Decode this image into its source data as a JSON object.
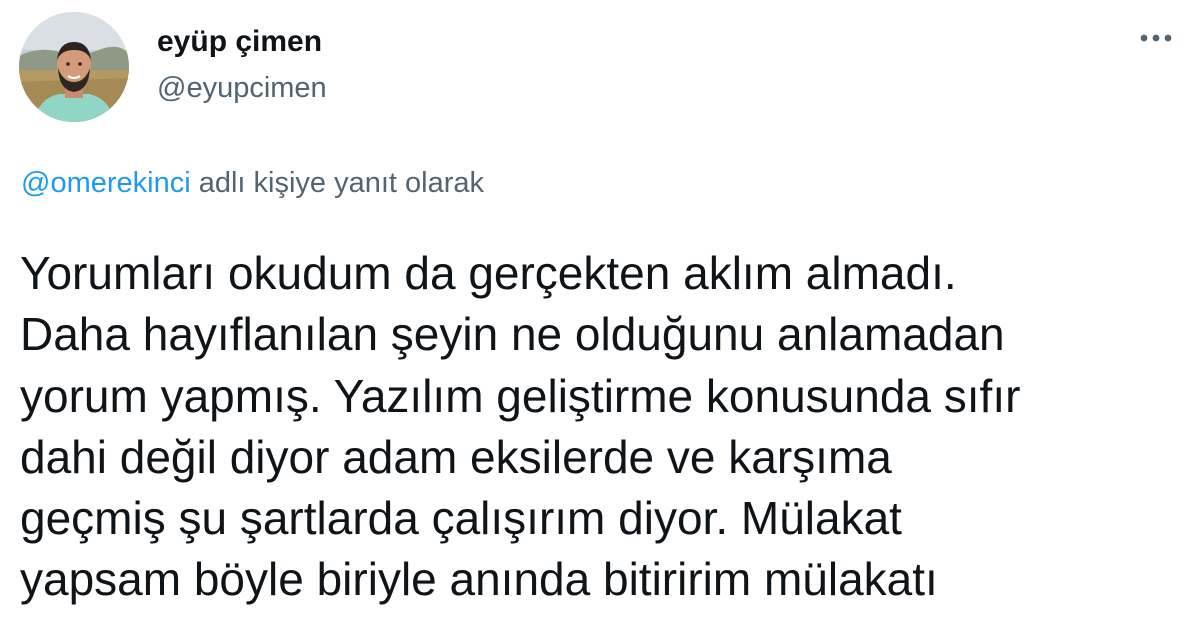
{
  "author": {
    "name": "eyüp çimen",
    "handle": "@eyupcimen"
  },
  "reply": {
    "handle": "@omerekinci",
    "suffix": " adlı kişiye yanıt olarak"
  },
  "tweet": {
    "lines": [
      "Yorumları okudum da gerçekten aklım almadı.",
      "Daha hayıflanılan şeyin ne olduğunu anlamadan",
      "yorum yapmış. Yazılım geliştirme konusunda sıfır",
      "dahi değil diyor adam eksilerde ve karşıma",
      "geçmiş şu şartlarda çalışırım diyor. Mülakat",
      "yapsam böyle biriyle anında bitiririm mülakatı"
    ]
  },
  "icons": {
    "more": "more-horizontal-icon",
    "avatar": "profile-photo"
  },
  "colors": {
    "link": "#1d9bf0",
    "secondary_text": "#536471",
    "primary_text": "#0f1419"
  }
}
